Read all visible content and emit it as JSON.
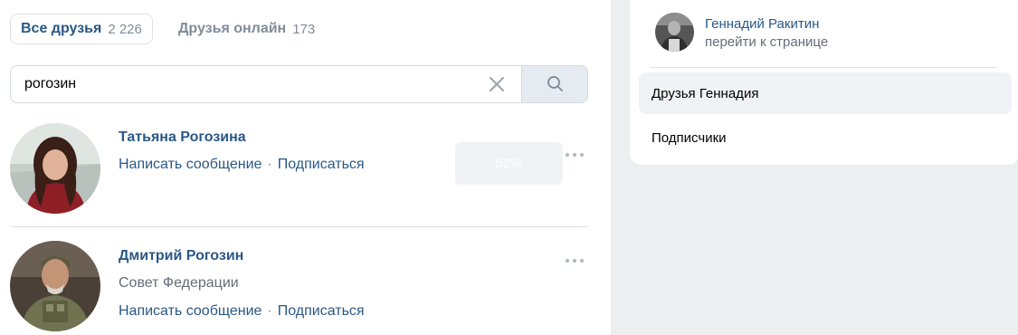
{
  "tabs": {
    "all_label": "Все друзья",
    "all_count": "2 226",
    "online_label": "Друзья онлайн",
    "online_count": "173"
  },
  "search": {
    "value": "рогозин",
    "clear_icon": "close-icon",
    "button_icon": "search-icon"
  },
  "results": [
    {
      "name": "Татьяна Рогозина",
      "actions": [
        "Написать сообщение",
        "Подписаться"
      ],
      "progress": "52%",
      "menu_icon": "more-icon"
    },
    {
      "name": "Дмитрий Рогозин",
      "subtitle": "Совет Федерации",
      "actions": [
        "Написать сообщение",
        "Подписаться"
      ],
      "menu_icon": "more-icon"
    }
  ],
  "sidebar": {
    "profile_name": "Геннадий Ракитин",
    "profile_link": "перейти к странице",
    "items": [
      {
        "label": "Друзья Геннадия",
        "active": true
      },
      {
        "label": "Подписчики",
        "active": false
      }
    ]
  },
  "colors": {
    "link": "#2a5885",
    "muted": "#818c99",
    "search_button_bg": "#e5ebf1",
    "sidebar_bg": "#edeef0"
  }
}
